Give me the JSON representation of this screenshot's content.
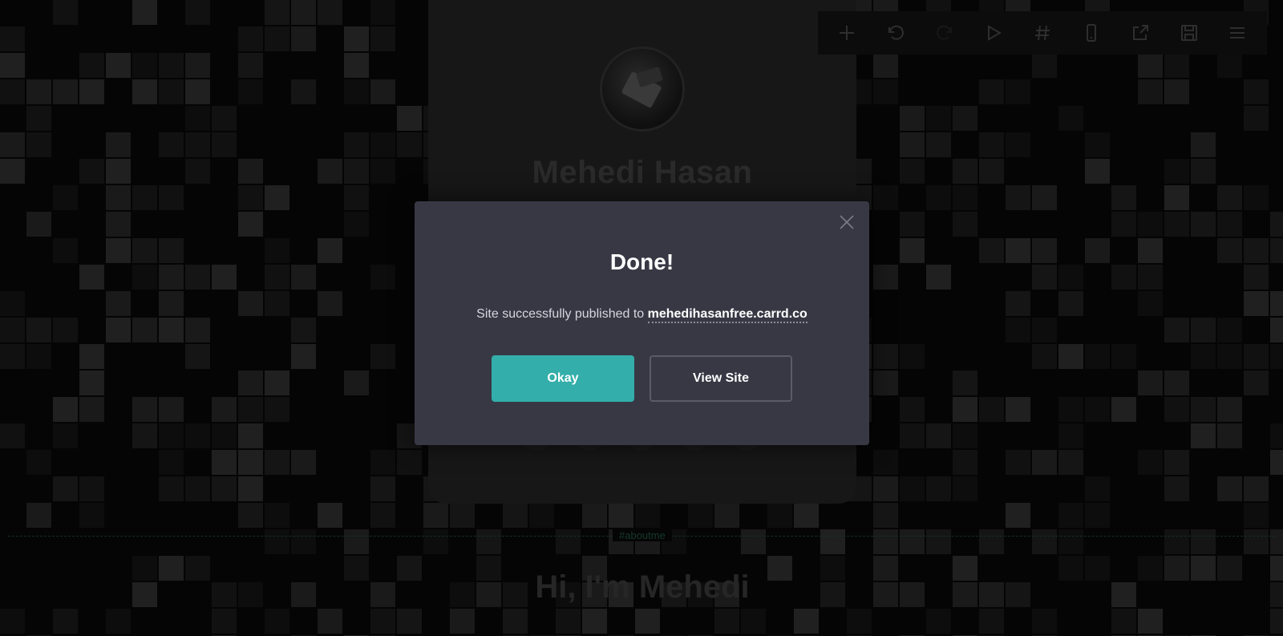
{
  "toolbar": {
    "buttons": [
      {
        "icon": "plus-icon"
      },
      {
        "icon": "undo-icon"
      },
      {
        "icon": "redo-icon"
      },
      {
        "icon": "play-icon"
      },
      {
        "icon": "hash-icon"
      },
      {
        "icon": "mobile-icon"
      },
      {
        "icon": "external-link-icon"
      },
      {
        "icon": "save-icon"
      },
      {
        "icon": "menu-icon"
      }
    ]
  },
  "profile": {
    "name": "Mehedi Hasan"
  },
  "section": {
    "tag": "#aboutme",
    "heading": "Hi, I'm Mehedi"
  },
  "modal": {
    "title": "Done!",
    "message_prefix": "Site successfully published to",
    "site_url": "mehedihasanfree.carrd.co",
    "okay_label": "Okay",
    "view_site_label": "View Site"
  },
  "colors": {
    "background": "#050505",
    "modal_bg": "#383845",
    "accent": "#33aeaa"
  }
}
